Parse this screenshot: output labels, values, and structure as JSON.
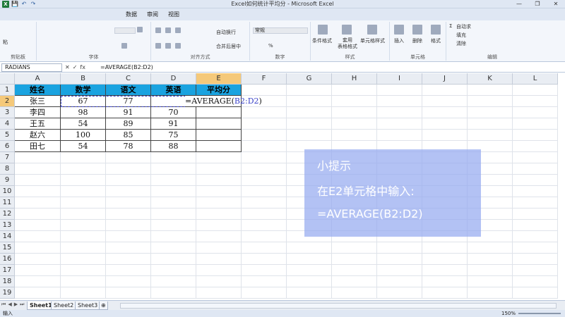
{
  "window": {
    "title": "Excel如何统计平均分 - Microsoft Excel",
    "controls": [
      "—",
      "❐",
      "✕"
    ]
  },
  "qat": {
    "app": "X",
    "items": [
      "💾",
      "↶",
      "↷"
    ]
  },
  "menu": {
    "tabs": [
      "数据",
      "审阅",
      "视图"
    ]
  },
  "ribbon": {
    "clipboard": {
      "label": "剪贴板",
      "paste": "粘"
    },
    "font": {
      "label": "字体"
    },
    "alignment": {
      "label": "对齐方式",
      "wrap": "自动换行",
      "merge": "合并后居中"
    },
    "number": {
      "label": "数字",
      "format": "常规",
      "percent": "%"
    },
    "styles": {
      "label": "样式",
      "conditional": "条件格式",
      "table": "套用\n表格格式",
      "cell": "单元格样式"
    },
    "cells": {
      "label": "单元格",
      "insert": "插入",
      "delete": "删除",
      "format": "格式"
    },
    "editing": {
      "label": "编辑",
      "autosum": "自动求",
      "fill": "填充",
      "clear": "清除"
    }
  },
  "formulabar": {
    "namebox": "RADIANS",
    "buttons": [
      "✕",
      "✓",
      "fx"
    ],
    "formula": "=AVERAGE(B2:D2)"
  },
  "grid": {
    "columns": [
      "A",
      "B",
      "C",
      "D",
      "E",
      "F",
      "G",
      "H",
      "I",
      "J",
      "K",
      "L"
    ],
    "rows": [
      "1",
      "2",
      "3",
      "4",
      "5",
      "6",
      "7",
      "8",
      "9",
      "10",
      "11",
      "12",
      "13",
      "14",
      "15",
      "16",
      "17",
      "18",
      "19"
    ],
    "headers": [
      "姓名",
      "数学",
      "语文",
      "英语",
      "平均分"
    ],
    "data": [
      [
        "张三",
        "67",
        "77",
        "",
        ""
      ],
      [
        "李四",
        "98",
        "91",
        "70",
        ""
      ],
      [
        "王五",
        "54",
        "89",
        "91",
        ""
      ],
      [
        "赵六",
        "100",
        "85",
        "75",
        ""
      ],
      [
        "田七",
        "54",
        "78",
        "88",
        ""
      ]
    ],
    "editing_cell": {
      "prefix": "=AVERAGE(",
      "ref": "B2:D2",
      "suffix": ")"
    }
  },
  "tip": {
    "title": "小提示",
    "line1": "在E2单元格中输入:",
    "line2": "=AVERAGE(B2:D2)"
  },
  "sheets": [
    "Sheet1",
    "Sheet2",
    "Sheet3"
  ],
  "status": {
    "mode": "输入",
    "zoom": "150%"
  }
}
